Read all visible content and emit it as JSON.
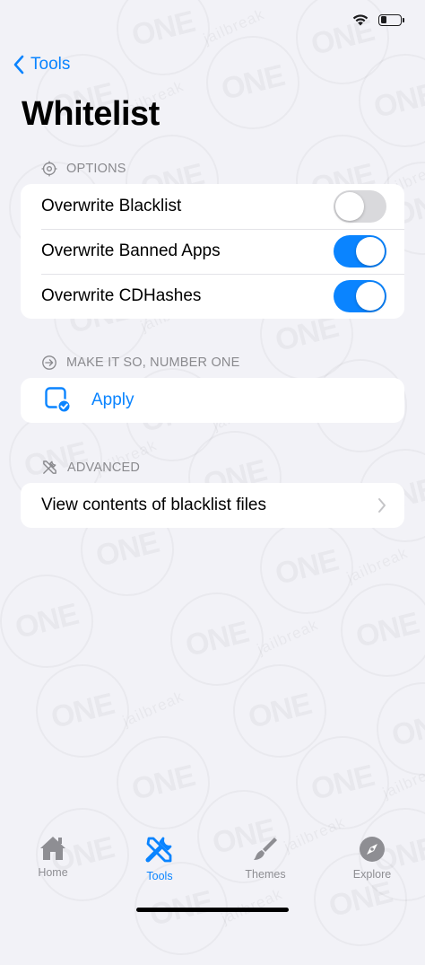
{
  "nav": {
    "back_label": "Tools",
    "title": "Whitelist"
  },
  "sections": {
    "options": {
      "header": "OPTIONS",
      "rows": [
        {
          "label": "Overwrite Blacklist",
          "on": false
        },
        {
          "label": "Overwrite Banned Apps",
          "on": true
        },
        {
          "label": "Overwrite CDHashes",
          "on": true
        }
      ]
    },
    "action": {
      "header": "MAKE IT SO, NUMBER ONE",
      "apply_label": "Apply"
    },
    "advanced": {
      "header": "ADVANCED",
      "view_label": "View contents of blacklist files"
    }
  },
  "tabbar": {
    "home": "Home",
    "tools": "Tools",
    "themes": "Themes",
    "explore": "Explore"
  },
  "watermark": {
    "logo": "ONE",
    "sub": "jailbreak"
  },
  "status": {
    "battery_level": 0.3
  },
  "colors": {
    "accent": "#0a84ff",
    "background": "#f2f2f7",
    "toggle_off": "#d9d9dc"
  }
}
